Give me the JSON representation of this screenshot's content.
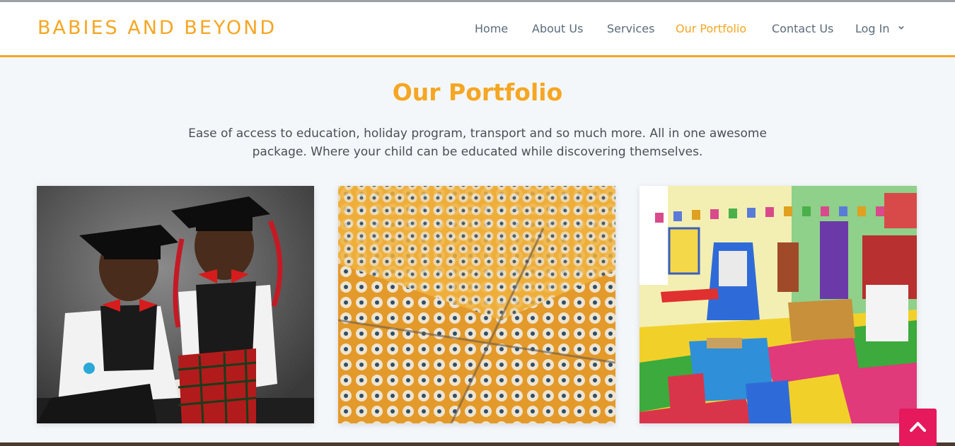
{
  "header": {
    "brand": "BABIES AND BEYOND",
    "nav": [
      {
        "label": "Home",
        "active": false
      },
      {
        "label": "About Us",
        "active": false
      },
      {
        "label": "Services",
        "active": false
      },
      {
        "label": "Our Portfolio",
        "active": true
      },
      {
        "label": "Contact Us",
        "active": false
      },
      {
        "label": "Log In",
        "active": false,
        "dropdown": true
      }
    ]
  },
  "main": {
    "title": "Our Portfolio",
    "description": "Ease of access to education, holiday program, transport and so much more. All in one awesome package. Where your child can be educated while discovering themselves."
  },
  "colors": {
    "accent": "#f5a623",
    "nav_text": "#5b6b7b",
    "back_to_top": "#e5195c"
  },
  "icons": {
    "login_dropdown": "chevron-down-icon",
    "back_to_top": "chevron-up-icon"
  }
}
